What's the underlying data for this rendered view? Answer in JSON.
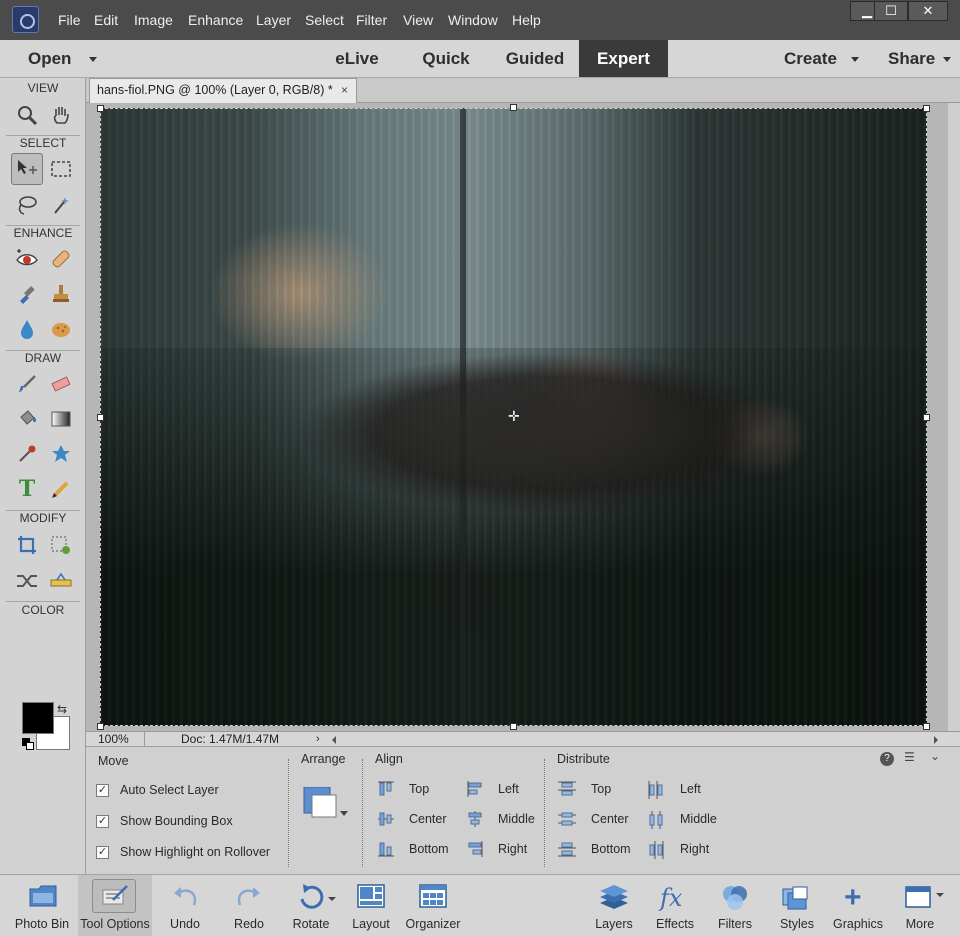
{
  "window": {
    "minimize": "▁",
    "maximize": "☐",
    "close": "✕"
  },
  "menu": [
    {
      "label": "File"
    },
    {
      "label": "Edit"
    },
    {
      "label": "Image"
    },
    {
      "label": "Enhance"
    },
    {
      "label": "Layer"
    },
    {
      "label": "Select"
    },
    {
      "label": "Filter"
    },
    {
      "label": "View"
    },
    {
      "label": "Window"
    },
    {
      "label": "Help"
    }
  ],
  "modebar": {
    "open": "Open",
    "modes": [
      "eLive",
      "Quick",
      "Guided",
      "Expert"
    ],
    "active_mode": "Expert",
    "create": "Create",
    "share": "Share"
  },
  "toolbox": {
    "sections": {
      "view": "VIEW",
      "select": "SELECT",
      "enhance": "ENHANCE",
      "draw": "DRAW",
      "modify": "MODIFY",
      "color": "COLOR"
    },
    "type_tool_glyph": "T"
  },
  "document": {
    "tab_title": "hans-fiol.PNG @ 100% (Layer 0, RGB/8) *",
    "tab_close": "×",
    "zoom": "100%",
    "doc_size": "Doc: 1.47M/1.47M",
    "status_arrow": "›"
  },
  "options": {
    "move_title": "Move",
    "checkboxes": [
      {
        "label": "Auto Select Layer",
        "checked": true,
        "mark": "✓"
      },
      {
        "label": "Show Bounding Box",
        "checked": true,
        "mark": "✓"
      },
      {
        "label": "Show Highlight on Rollover",
        "checked": true,
        "mark": "✓"
      }
    ],
    "arrange_title": "Arrange",
    "align_title": "Align",
    "align": {
      "top": "Top",
      "center": "Center",
      "bottom": "Bottom",
      "left": "Left",
      "middle": "Middle",
      "right": "Right"
    },
    "distribute_title": "Distribute",
    "distribute": {
      "top": "Top",
      "center": "Center",
      "bottom": "Bottom",
      "left": "Left",
      "middle": "Middle",
      "right": "Right"
    },
    "help": "?",
    "menu": "☰",
    "collapse": "⌄"
  },
  "bottombar": {
    "photo_bin": "Photo Bin",
    "tool_options": "Tool Options",
    "undo": "Undo",
    "redo": "Redo",
    "rotate": "Rotate",
    "layout": "Layout",
    "organizer": "Organizer",
    "layers": "Layers",
    "effects": "Effects",
    "filters": "Filters",
    "styles": "Styles",
    "graphics": "Graphics",
    "more": "More"
  },
  "colors": {
    "foreground": "#000000",
    "background": "#ffffff",
    "accent_blue": "#3d6fb0",
    "mode_active_bg": "#3a3a3a"
  }
}
